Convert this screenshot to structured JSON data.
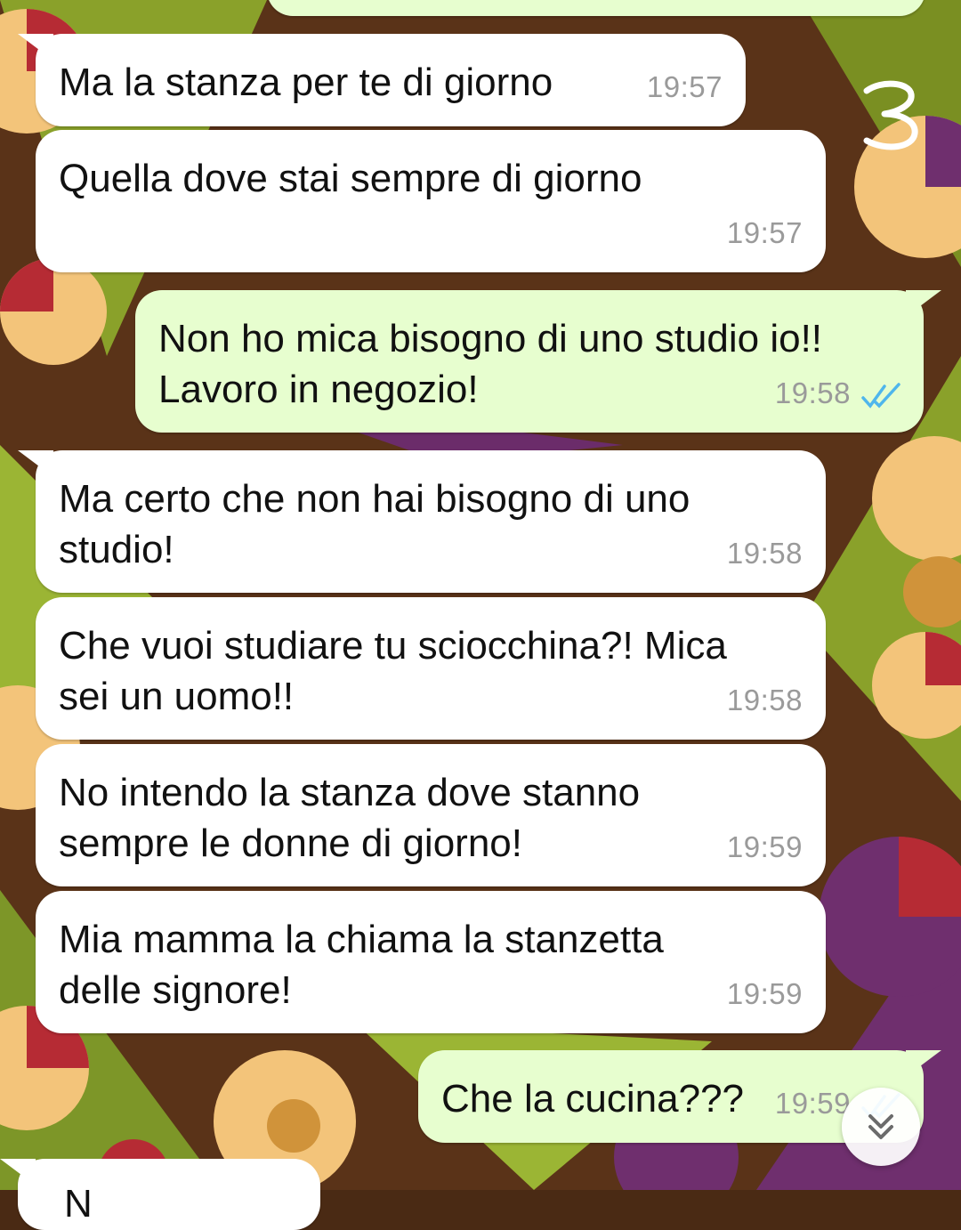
{
  "messages": [
    {
      "direction": "in",
      "text": "Ma la stanza per te di giorno",
      "time": "19:57"
    },
    {
      "direction": "in",
      "text": "Quella dove stai sempre di giorno",
      "time": "19:57"
    },
    {
      "direction": "out",
      "text": "Non ho mica bisogno di uno studio io!!\nLavoro in negozio!",
      "time": "19:58",
      "status": "read"
    },
    {
      "direction": "in",
      "text": "Ma certo che non hai bisogno di uno\nstudio!",
      "time": "19:58"
    },
    {
      "direction": "in",
      "text": "Che vuoi studiare tu sciocchina?! Mica\nsei un uomo!!",
      "time": "19:58"
    },
    {
      "direction": "in",
      "text": "No intendo la stanza dove stanno\nsempre le donne di giorno!",
      "time": "19:59"
    },
    {
      "direction": "in",
      "text": "Mia mamma la chiama la stanzetta\ndelle signore!",
      "time": "19:59"
    },
    {
      "direction": "out",
      "text": "Che la cucina???",
      "time": "19:59",
      "status": "read"
    },
    {
      "direction": "in",
      "text": "N",
      "time": ""
    }
  ],
  "annotation": "3",
  "icons": {
    "read_receipt": "double-check-icon",
    "scroll_down": "chevron-double-down-icon"
  },
  "colors": {
    "incoming_bubble": "#ffffff",
    "outgoing_bubble": "#e7fecf",
    "timestamp": "#9a9a9a",
    "read_tick": "#4fb6ec"
  }
}
